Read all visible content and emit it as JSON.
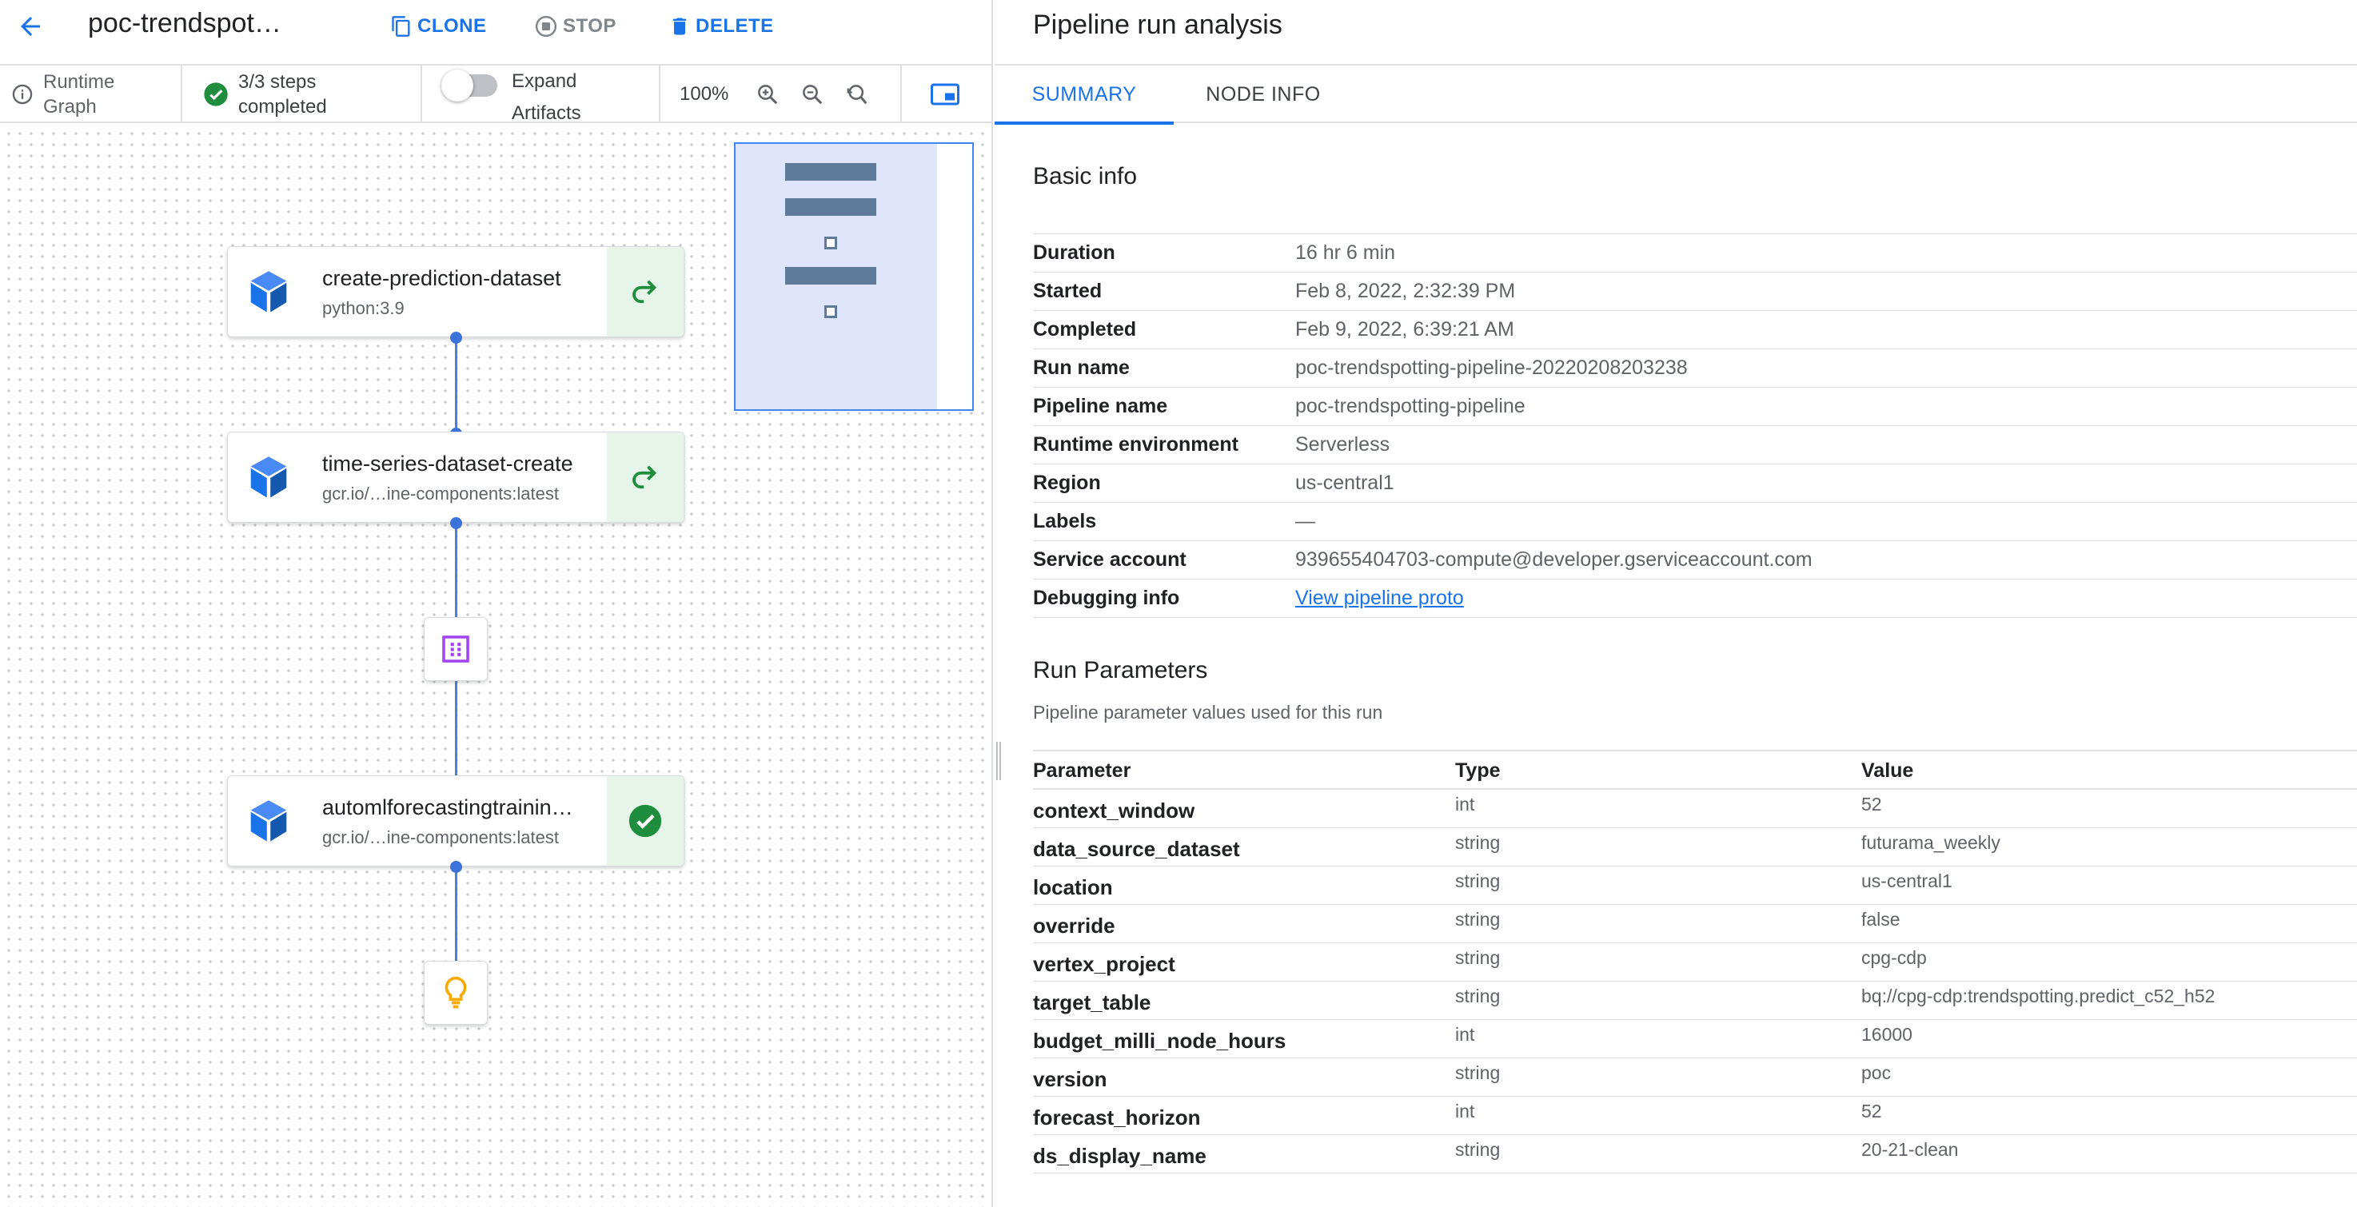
{
  "header": {
    "pipeline_title": "poc-trendspot…",
    "actions": {
      "clone": "CLONE",
      "stop": "STOP",
      "delete": "DELETE"
    }
  },
  "graph_toolbar": {
    "runtime_graph": "Runtime Graph",
    "steps_completed": "3/3 steps completed",
    "expand_artifacts": "Expand Artifacts",
    "expand_artifacts_on": false,
    "zoom_level": "100%"
  },
  "graph": {
    "nodes": [
      {
        "name": "create-prediction-dataset",
        "subtitle": "python:3.9",
        "status": "cached"
      },
      {
        "name": "time-series-dataset-create",
        "subtitle": "gcr.io/…ine-components:latest",
        "status": "cached"
      },
      {
        "name": "automlforecastingtrainin…",
        "subtitle": "gcr.io/…ine-components:latest",
        "status": "succeeded"
      }
    ],
    "artifact_nodes": [
      {
        "kind": "dataset-artifact-icon"
      },
      {
        "kind": "model-artifact-icon"
      }
    ]
  },
  "analysis": {
    "title": "Pipeline run analysis",
    "tabs": [
      "SUMMARY",
      "NODE INFO"
    ],
    "active_tab": "SUMMARY",
    "basic_info": {
      "heading": "Basic info",
      "rows": [
        {
          "key": "Duration",
          "value": "16 hr 6 min"
        },
        {
          "key": "Started",
          "value": "Feb 8, 2022, 2:32:39 PM"
        },
        {
          "key": "Completed",
          "value": "Feb 9, 2022, 6:39:21 AM"
        },
        {
          "key": "Run name",
          "value": "poc-trendspotting-pipeline-20220208203238"
        },
        {
          "key": "Pipeline name",
          "value": "poc-trendspotting-pipeline"
        },
        {
          "key": "Runtime environment",
          "value": "Serverless"
        },
        {
          "key": "Region",
          "value": "us-central1"
        },
        {
          "key": "Labels",
          "value": "—"
        },
        {
          "key": "Service account",
          "value": "939655404703-compute@developer.gserviceaccount.com"
        },
        {
          "key": "Debugging info",
          "value": "View pipeline proto"
        }
      ]
    },
    "run_parameters": {
      "heading": "Run Parameters",
      "description": "Pipeline parameter values used for this run",
      "columns": [
        "Parameter",
        "Type",
        "Value"
      ],
      "rows": [
        [
          "context_window",
          "int",
          "52"
        ],
        [
          "data_source_dataset",
          "string",
          "futurama_weekly"
        ],
        [
          "location",
          "string",
          "us-central1"
        ],
        [
          "override",
          "string",
          "false"
        ],
        [
          "vertex_project",
          "string",
          "cpg-cdp"
        ],
        [
          "target_table",
          "string",
          "bq://cpg-cdp:trendspotting.predict_c52_h52"
        ],
        [
          "budget_milli_node_hours",
          "int",
          "16000"
        ],
        [
          "version",
          "string",
          "poc"
        ],
        [
          "forecast_horizon",
          "int",
          "52"
        ],
        [
          "ds_display_name",
          "string",
          "20-21-clean"
        ]
      ]
    }
  },
  "colors": {
    "accent": "#1a73e8",
    "success": "#1e8e3e",
    "status_bg": "#e6f4ea",
    "node_icon": "#1a73e8",
    "edge": "#4a7fe0",
    "artifact_dataset": "#a142f4",
    "artifact_model": "#f9ab00"
  }
}
